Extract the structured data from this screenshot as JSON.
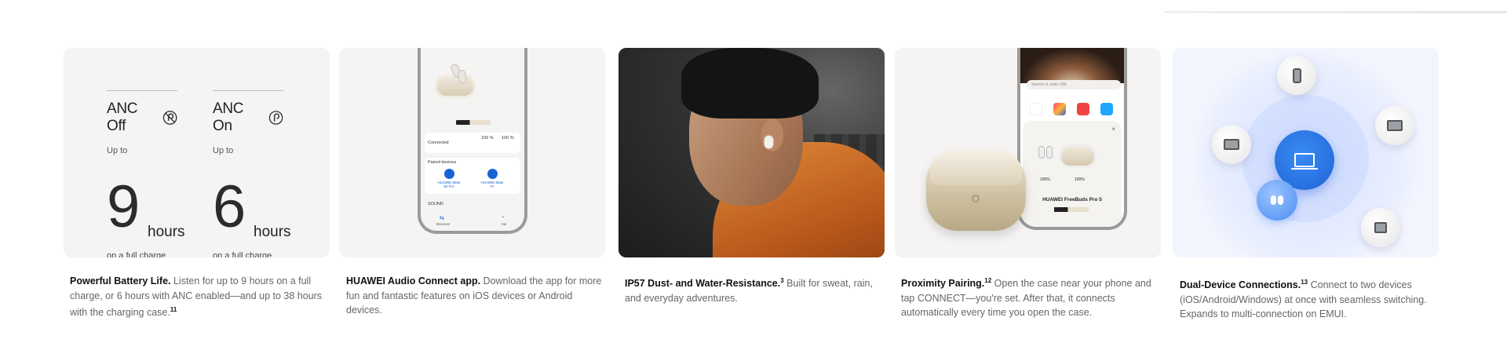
{
  "cards": {
    "battery": {
      "off": {
        "label": "ANC Off",
        "upto": "Up to",
        "value": "9",
        "unit": "hours",
        "note": "on a full charge"
      },
      "on": {
        "label": "ANC On",
        "upto": "Up to",
        "value": "6",
        "unit": "hours",
        "note": "on a full charge"
      },
      "caption_title": "Powerful Battery Life.",
      "caption_body": "Listen for up to 9 hours on a full charge, or 6 hours with ANC enabled—and up to 38 hours with the charging case.",
      "caption_sup": "11"
    },
    "app": {
      "phone": {
        "connected": "Connected",
        "left_pct": "100 %",
        "right_pct": "100 %",
        "paired_title": "Paired devices",
        "device1": "HUAWEI Mate 60 Pro",
        "device2": "HUAWEI Mate X7",
        "sound": "SOUND",
        "nav1": "Discover",
        "nav2": "Me"
      },
      "caption_title": "HUAWEI Audio Connect app.",
      "caption_body": "Download the app for more fun and fantastic features on iOS devices or Android devices."
    },
    "photo": {
      "caption_title": "IP57 Dust- and Water-Resistance.",
      "caption_sup": "3",
      "caption_body": "Built for sweat, rain, and everyday adventures."
    },
    "proximity": {
      "phone": {
        "url_placeholder": "Search or enter URL",
        "pct_left": "100%",
        "pct_right": "100%",
        "product_name": "HUAWEI FreeBuds Pro 5",
        "close": "×"
      },
      "caption_title": "Proximity Pairing.",
      "caption_sup": "12",
      "caption_body": "Open the case near your phone and tap CONNECT—you're set. After that, it connects automatically every time you open the case."
    },
    "dual": {
      "caption_title": "Dual-Device Connections.",
      "caption_sup": "13",
      "caption_body": "Connect to two devices (iOS/Android/Windows) at once with seamless switching. Expands to multi-connection on EMUI."
    }
  },
  "colors": {
    "card_bg": "#f5f4f2",
    "dual_bg": "#f3f5fe",
    "hub_blue": "#1f63d8",
    "shirt_orange": "#d87a30"
  }
}
